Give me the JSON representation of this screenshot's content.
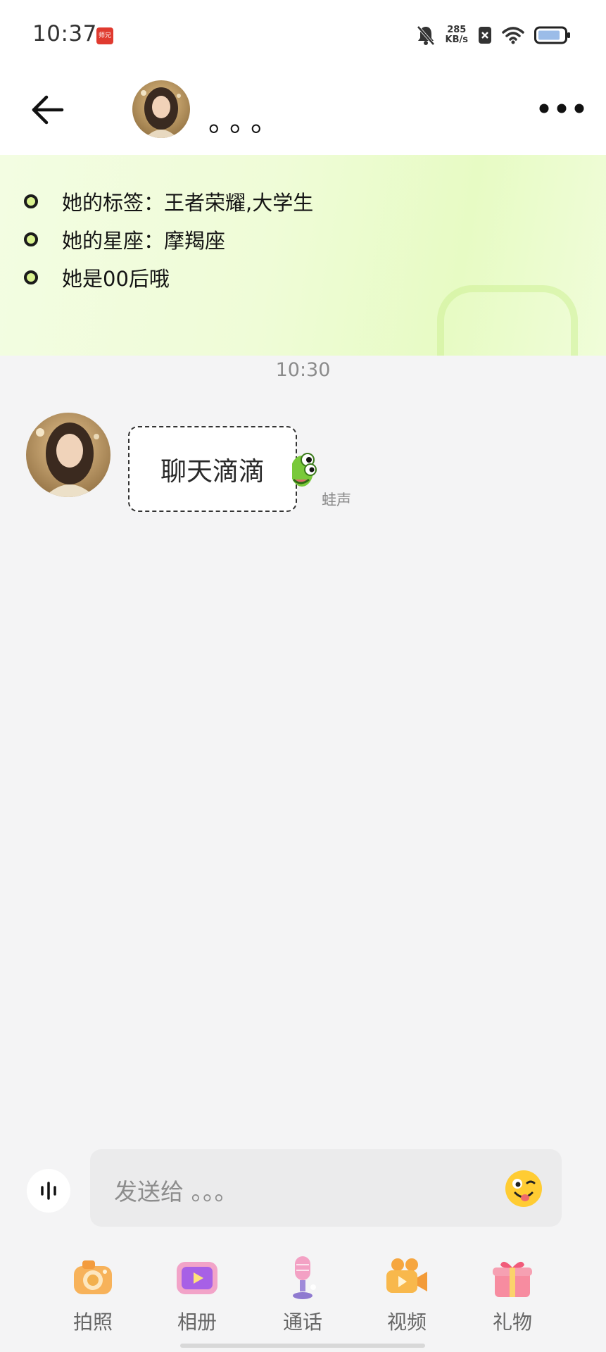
{
  "status_bar": {
    "time": "10:37",
    "app_badge": "师兄",
    "speed_value": "285",
    "speed_unit": "KB/s"
  },
  "header": {
    "name": "。。。"
  },
  "profile_banner": {
    "items": [
      "她的标签：王者荣耀,大学生",
      "她的星座：摩羯座",
      "她是00后哦"
    ]
  },
  "chat": {
    "timestamp": "10:30",
    "messages": [
      {
        "text": "聊天滴滴",
        "tag": "蛙声"
      }
    ]
  },
  "input": {
    "placeholder": "发送给 。。。"
  },
  "toolbar": {
    "items": [
      {
        "label": "拍照",
        "icon": "camera-icon"
      },
      {
        "label": "相册",
        "icon": "album-icon"
      },
      {
        "label": "通话",
        "icon": "microphone-icon"
      },
      {
        "label": "视频",
        "icon": "video-camera-icon"
      },
      {
        "label": "礼物",
        "icon": "gift-icon"
      }
    ]
  },
  "colors": {
    "banner_green": "#e7fbc4",
    "bullet_fill": "#d9f28f",
    "background": "#f4f4f5"
  }
}
